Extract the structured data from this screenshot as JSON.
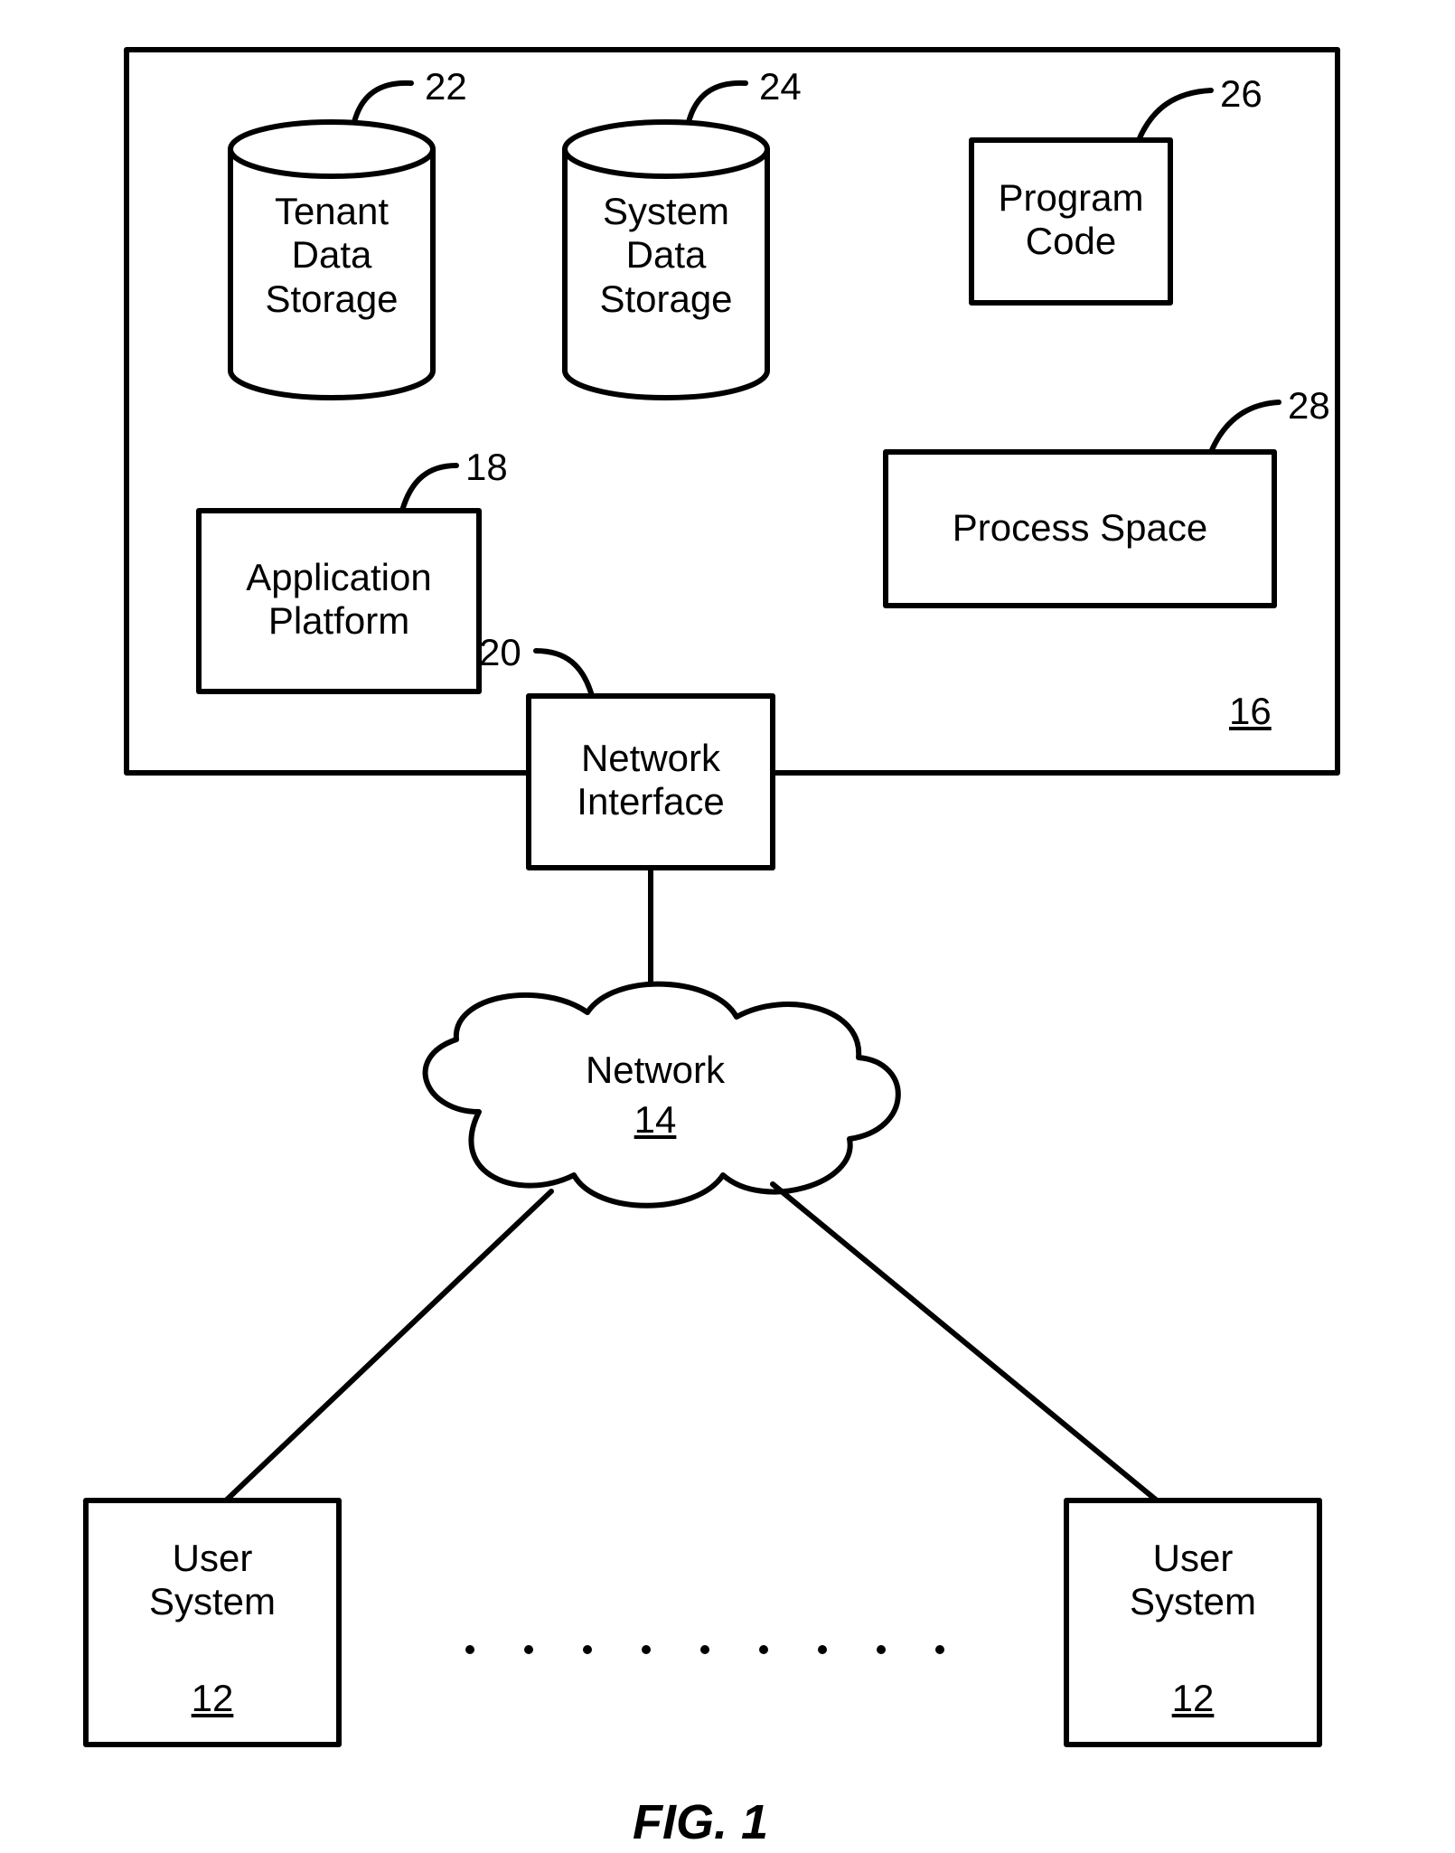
{
  "figure_caption": "FIG. 1",
  "server_box": {
    "ref": "16"
  },
  "tenant_data_storage": {
    "label": "Tenant\nData\nStorage",
    "ref": "22"
  },
  "system_data_storage": {
    "label": "System\nData\nStorage",
    "ref": "24"
  },
  "program_code": {
    "label": "Program\nCode",
    "ref": "26"
  },
  "application_platform": {
    "label": "Application\nPlatform",
    "ref": "18"
  },
  "process_space": {
    "label": "Process Space",
    "ref": "28"
  },
  "network_interface": {
    "label": "Network\nInterface",
    "ref": "20"
  },
  "network": {
    "label": "Network",
    "ref": "14"
  },
  "user_system_left": {
    "label": "User\nSystem",
    "ref": "12"
  },
  "user_system_right": {
    "label": "User\nSystem",
    "ref": "12"
  }
}
